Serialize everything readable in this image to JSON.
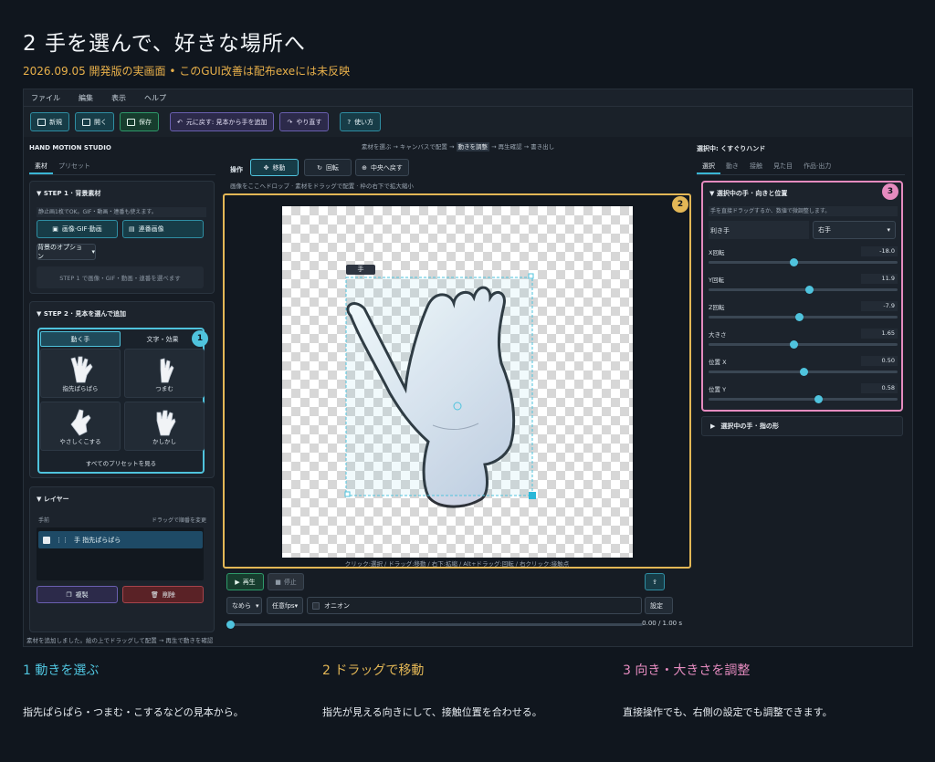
{
  "header": {
    "title": "2 手を選んで、好きな場所へ",
    "subtitle": "2026.09.05 開発版の実画面 • このGUI改善は配布exeには未反映"
  },
  "menu": [
    "ファイル",
    "編集",
    "表示",
    "ヘルプ"
  ],
  "toolbar": {
    "new": "新規",
    "open": "開く",
    "save": "保存",
    "undo": "元に戻す: 見本から手を追加",
    "redo": "やり直す",
    "help": "使い方"
  },
  "left": {
    "brand": "HAND MOTION STUDIO",
    "tabs": [
      "素材",
      "プリセット"
    ],
    "step1": {
      "title": "STEP 1 · 背景素材",
      "hint": "静止画1枚でOK。GIF・動画・連番も使えます。",
      "btn_media": "画像·GIF·動画",
      "btn_seq": "連番画像",
      "options": "背景のオプション",
      "placeholder": "STEP 1 で画像・GIF・動画・連番を選べます"
    },
    "step2": {
      "title": "STEP 2 · 見本を選んで追加",
      "tab_motion": "動く手",
      "tab_text": "文字・効果",
      "tiles": [
        "指先ぱらぱら",
        "つまむ",
        "やさしくこする",
        "かしかし"
      ],
      "all_presets": "すべてのプリセットを見る"
    },
    "layers": {
      "title": "レイヤー",
      "front": "手前",
      "drag_hint": "ドラッグで順番を変更",
      "item": "手  指先ぱらぱら",
      "duplicate": "複製",
      "delete": "削除"
    },
    "status": "素材を追加しました。絵の上でドラッグして配置 → 再生で動きを確認"
  },
  "center": {
    "breadcrumbs": {
      "before": "素材を選ぶ → キャンバスで配置 →",
      "current": "動きを調整",
      "after": "→ 再生確認 → 書き出し"
    },
    "op_label": "操作",
    "btn_move": "移動",
    "btn_rotate": "回転",
    "btn_center": "中央へ戻す",
    "canvas_hint": "画像をここへドロップ · 素材をドラッグで配置 · 枠の右下で拡大縮小",
    "hand_tag": "手",
    "canvas_footer": "クリック:選択 / ドラッグ:移動 / 右下:拡縮 / Alt+ドラッグ:回転 / 右クリック:接触点",
    "play": "再生",
    "stop": "停止",
    "easing": "なめら",
    "fps": "任意fps",
    "onion": "オニオン",
    "settings": "設定",
    "time": "0.00 / 1.00 s",
    "progress": 0.0
  },
  "right": {
    "selected": "選択中: くすぐりハンド",
    "tabs": [
      "選択",
      "動き",
      "接触",
      "見た目",
      "作品·出力"
    ],
    "section": "選択中の手 · 向きと位置",
    "hint": "手を直接ドラッグするか、数値で微調整します。",
    "hand_label": "利き手",
    "hand_value": "右手",
    "props": [
      {
        "label": "X回転",
        "value": "-18.0",
        "pos": 0.45
      },
      {
        "label": "Y回転",
        "value": "11.9",
        "pos": 0.53
      },
      {
        "label": "Z回転",
        "value": "-7.9",
        "pos": 0.48
      },
      {
        "label": "大きさ",
        "value": "1.65",
        "pos": 0.45
      },
      {
        "label": "位置 X",
        "value": "0.50",
        "pos": 0.5
      },
      {
        "label": "位置 Y",
        "value": "0.58",
        "pos": 0.58
      }
    ],
    "finger_section": "選択中の手 · 指の形"
  },
  "badges": [
    "1",
    "2",
    "3"
  ],
  "bottom": [
    {
      "title": "1 動きを選ぶ",
      "desc": "指先ぱらぱら・つまむ・こするなどの見本から。"
    },
    {
      "title": "2 ドラッグで移動",
      "desc": "指先が見える向きにして、接触位置を合わせる。"
    },
    {
      "title": "3 向き・大きさを調整",
      "desc": "直接操作でも、右側の設定でも調整できます。"
    }
  ],
  "colors": {
    "accent": "#4fc3dd",
    "badge1": "#4fc3dd",
    "badge2": "#e3b756",
    "badge3": "#e58bbf"
  }
}
